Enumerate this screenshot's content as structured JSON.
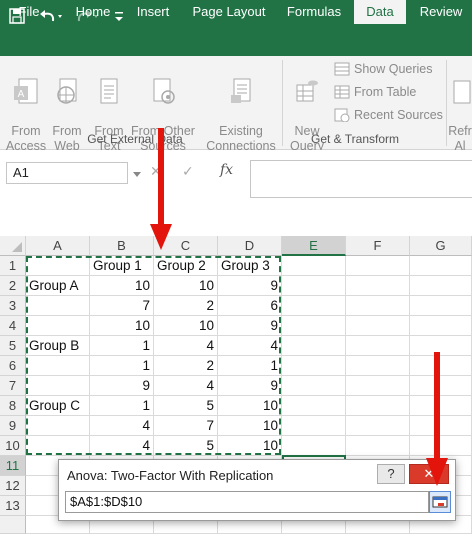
{
  "ribbon_tabs": {
    "file": "File",
    "home": "Home",
    "insert": "Insert",
    "page_layout": "Page Layout",
    "formulas": "Formulas",
    "data": "Data",
    "review": "Review"
  },
  "ribbon": {
    "from_access": "From\nAccess",
    "from_web": "From\nWeb",
    "from_text": "From\nText",
    "from_other_sources": "From Other\nSources",
    "existing_connections": "Existing\nConnections",
    "get_external_data": "Get External Data",
    "new_query": "New\nQuery",
    "show_queries": "Show Queries",
    "from_table": "From Table",
    "recent_sources": "Recent Sources",
    "get_transform": "Get & Transform",
    "refresh_all": "Refr\nAl"
  },
  "formula_bar": {
    "name_box": "A1",
    "fx": "fx"
  },
  "columns": [
    "A",
    "B",
    "C",
    "D",
    "E",
    "F",
    "G"
  ],
  "rows": [
    "1",
    "2",
    "3",
    "4",
    "5",
    "6",
    "7",
    "8",
    "9",
    "10",
    "11",
    "12",
    "13"
  ],
  "cells": {
    "B1": "Group 1",
    "C1": "Group 2",
    "D1": "Group 3",
    "A2": "Group A",
    "B2": "10",
    "C2": "10",
    "D2": "9",
    "B3": "7",
    "C3": "2",
    "D3": "6",
    "B4": "10",
    "C4": "10",
    "D4": "9",
    "A5": "Group B",
    "B5": "1",
    "C5": "4",
    "D5": "4",
    "B6": "1",
    "C6": "2",
    "D6": "1",
    "B7": "9",
    "C7": "4",
    "D7": "9",
    "A8": "Group C",
    "B8": "1",
    "C8": "5",
    "D8": "10",
    "B9": "4",
    "C9": "7",
    "D9": "10",
    "B10": "4",
    "C10": "5",
    "D10": "10"
  },
  "dialog": {
    "title": "Anova: Two-Factor With Replication",
    "help": "?",
    "close": "✕",
    "range_value": "$A$1:$D$10"
  },
  "colors": {
    "excel_green": "#217346",
    "arrow_red": "#e3140c"
  }
}
